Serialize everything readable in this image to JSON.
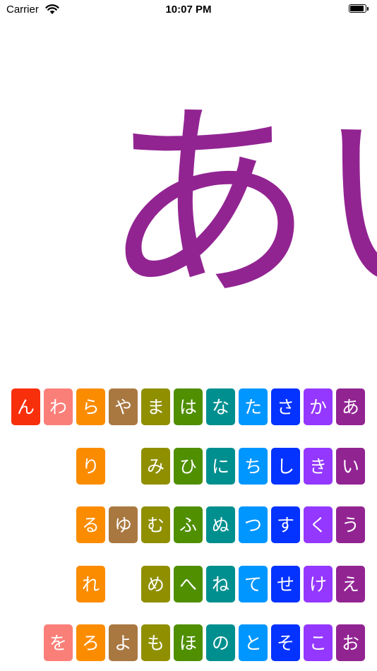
{
  "status_bar": {
    "carrier": "Carrier",
    "time": "10:07 PM"
  },
  "display": {
    "text": "あい",
    "color": "#922492"
  },
  "kana": {
    "rows": [
      [
        {
          "char": "ん",
          "color": "#f82f0b"
        },
        {
          "char": "わ",
          "color": "#fb7f79"
        },
        {
          "char": "ら",
          "color": "#fb8c00"
        },
        {
          "char": "や",
          "color": "#a97841"
        },
        {
          "char": "ま",
          "color": "#8f8f00"
        },
        {
          "char": "は",
          "color": "#4f8f00"
        },
        {
          "char": "な",
          "color": "#008f8f"
        },
        {
          "char": "た",
          "color": "#0096ff"
        },
        {
          "char": "さ",
          "color": "#0432ff"
        },
        {
          "char": "か",
          "color": "#9437ff"
        },
        {
          "char": "あ",
          "color": "#922492"
        }
      ],
      [
        null,
        null,
        {
          "char": "り",
          "color": "#fb8c00"
        },
        null,
        {
          "char": "み",
          "color": "#8f8f00"
        },
        {
          "char": "ひ",
          "color": "#4f8f00"
        },
        {
          "char": "に",
          "color": "#008f8f"
        },
        {
          "char": "ち",
          "color": "#0096ff"
        },
        {
          "char": "し",
          "color": "#0432ff"
        },
        {
          "char": "き",
          "color": "#9437ff"
        },
        {
          "char": "い",
          "color": "#922492"
        }
      ],
      [
        null,
        null,
        {
          "char": "る",
          "color": "#fb8c00"
        },
        {
          "char": "ゆ",
          "color": "#a97841"
        },
        {
          "char": "む",
          "color": "#8f8f00"
        },
        {
          "char": "ふ",
          "color": "#4f8f00"
        },
        {
          "char": "ぬ",
          "color": "#008f8f"
        },
        {
          "char": "つ",
          "color": "#0096ff"
        },
        {
          "char": "す",
          "color": "#0432ff"
        },
        {
          "char": "く",
          "color": "#9437ff"
        },
        {
          "char": "う",
          "color": "#922492"
        }
      ],
      [
        null,
        null,
        {
          "char": "れ",
          "color": "#fb8c00"
        },
        null,
        {
          "char": "め",
          "color": "#8f8f00"
        },
        {
          "char": "へ",
          "color": "#4f8f00"
        },
        {
          "char": "ね",
          "color": "#008f8f"
        },
        {
          "char": "て",
          "color": "#0096ff"
        },
        {
          "char": "せ",
          "color": "#0432ff"
        },
        {
          "char": "け",
          "color": "#9437ff"
        },
        {
          "char": "え",
          "color": "#922492"
        }
      ],
      [
        null,
        {
          "char": "を",
          "color": "#fb7f79"
        },
        {
          "char": "ろ",
          "color": "#fb8c00"
        },
        {
          "char": "よ",
          "color": "#a97841"
        },
        {
          "char": "も",
          "color": "#8f8f00"
        },
        {
          "char": "ほ",
          "color": "#4f8f00"
        },
        {
          "char": "の",
          "color": "#008f8f"
        },
        {
          "char": "と",
          "color": "#0096ff"
        },
        {
          "char": "そ",
          "color": "#0432ff"
        },
        {
          "char": "こ",
          "color": "#9437ff"
        },
        {
          "char": "お",
          "color": "#922492"
        }
      ]
    ]
  }
}
